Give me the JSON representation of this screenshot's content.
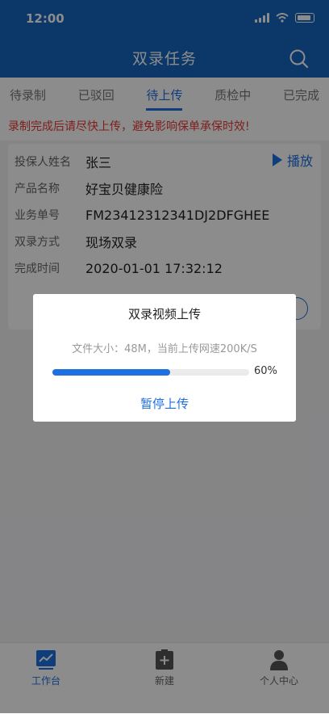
{
  "status_bar": {
    "time": "12:00"
  },
  "header": {
    "title": "双录任务"
  },
  "tabs": [
    {
      "label": "待录制"
    },
    {
      "label": "已驳回"
    },
    {
      "label": "待上传"
    },
    {
      "label": "质检中"
    },
    {
      "label": "已完成"
    }
  ],
  "active_tab": "待上传",
  "warning": "录制完成后请尽快上传，避免影响保单承保时效!",
  "card": {
    "play_label": "播放",
    "rows": [
      {
        "label": "投保人姓名",
        "value": "张三"
      },
      {
        "label": "产品名称",
        "value": "好宝贝健康险"
      },
      {
        "label": "业务单号",
        "value": "FM23412312341DJ2DFGHEE"
      },
      {
        "label": "双录方式",
        "value": "现场双录"
      },
      {
        "label": "完成时间",
        "value": "2020-01-01 17:32:12"
      }
    ]
  },
  "dialog": {
    "title": "双录视频上传",
    "info": "文件大小：48M，当前上传网速200K/S",
    "progress_fraction": 0.6,
    "progress_text": "60%",
    "pause_label": "暂停上传"
  },
  "bottom_nav": [
    {
      "label": "工作台",
      "icon": "chart-icon"
    },
    {
      "label": "新建",
      "icon": "add-doc-icon"
    },
    {
      "label": "个人中心",
      "icon": "person-icon"
    }
  ],
  "colors": {
    "header": "#1565c0",
    "accent": "#1e6fe0",
    "warning": "#e53935"
  }
}
